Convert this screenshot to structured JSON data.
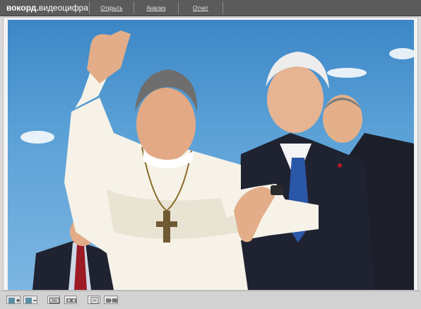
{
  "app": {
    "brand": {
      "bold": "вокорд.",
      "rest": "видеоцифра"
    },
    "menu": [
      {
        "label": "Открыть"
      },
      {
        "label": "Анализ"
      },
      {
        "label": "Отчет"
      }
    ]
  },
  "viewer": {
    "image": {
      "subject": "photo-of-people-against-sky"
    },
    "colors": {
      "sky_top": "#3c87c7",
      "sky_bottom": "#7db6e2",
      "robe": "#f6f2e8",
      "suit": "#1f2230"
    }
  },
  "toolbar": {
    "buttons": [
      {
        "icon": "zoom-in-icon"
      },
      {
        "icon": "zoom-out-icon"
      },
      {
        "icon": "fit-frame-icon"
      },
      {
        "icon": "film-strip-icon"
      },
      {
        "icon": "print-icon"
      },
      {
        "icon": "export-icon"
      }
    ]
  }
}
